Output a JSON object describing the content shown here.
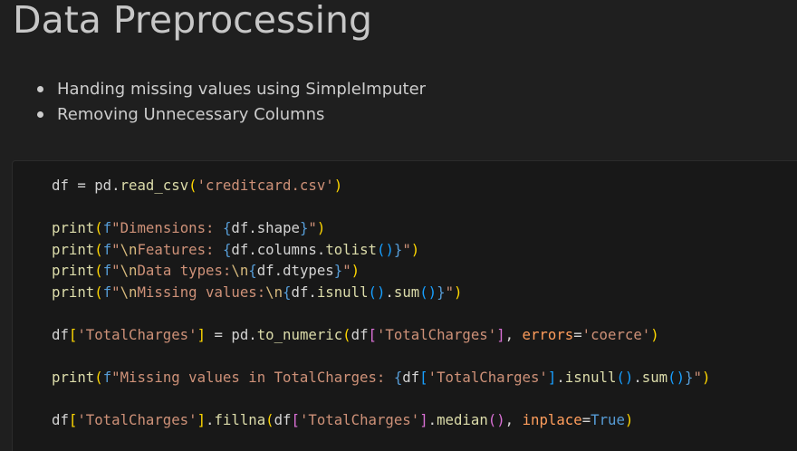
{
  "markdown": {
    "title": "Data Preprocessing",
    "bullets": [
      "Handing missing values using SimpleImputer",
      "Removing Unnecessary Columns"
    ]
  },
  "code_cell": {
    "lines": [
      "df = pd.read_csv('creditcard.csv')",
      "",
      "print(f\"Dimensions: {df.shape}\")",
      "print(f\"\\nFeatures: {df.columns.tolist()}\")",
      "print(f\"\\nData types:\\n{df.dtypes}\")",
      "print(f\"\\nMissing values:\\n{df.isnull().sum()}\")",
      "",
      "df['TotalCharges'] = pd.to_numeric(df['TotalCharges'], errors='coerce')",
      "",
      "print(f\"Missing values in TotalCharges: {df['TotalCharges'].isnull().sum()}\")",
      "",
      "df['TotalCharges'].fillna(df['TotalCharges'].median(), inplace=True)"
    ]
  },
  "colors": {
    "background": "#1f1f1f",
    "cell_background": "#181818",
    "text": "#cccccc",
    "string": "#ce9178",
    "function": "#dcdcaa",
    "keyword": "#569cd6",
    "escape": "#d7ba7d",
    "bracket_level1": "#ffd700",
    "bracket_level2": "#da70d6",
    "bracket_level3": "#179fff",
    "parameter": "#ff9d5c",
    "constant": "#4fc1ff"
  }
}
